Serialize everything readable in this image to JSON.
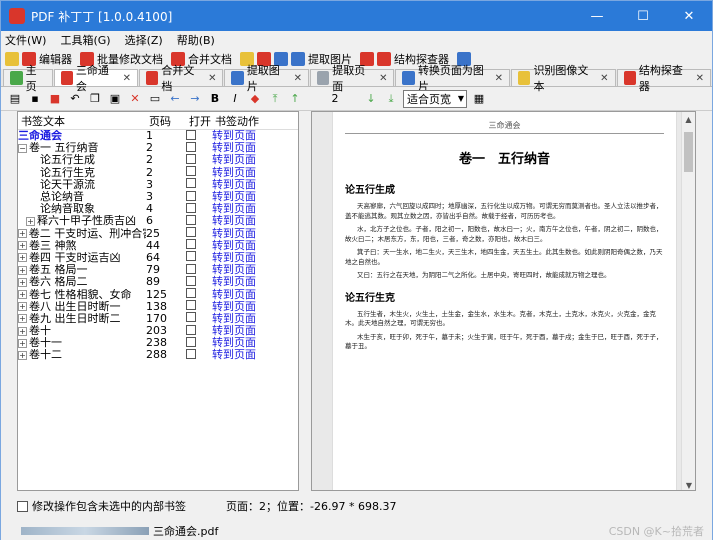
{
  "window": {
    "title": "PDF 补丁丁 [1.0.0.4100]",
    "controls": [
      "—",
      "☐",
      "✕"
    ]
  },
  "menu": [
    "文件(W)",
    "工具箱(G)",
    "选择(Z)",
    "帮助(B)"
  ],
  "toolbar1": [
    "编辑器",
    "批量修改文档",
    "合并文档",
    "提取图片",
    "结构探查器"
  ],
  "tabs": [
    {
      "label": "主页",
      "closable": false
    },
    {
      "label": "三命通会",
      "closable": true
    },
    {
      "label": "合并文档",
      "closable": true
    },
    {
      "label": "提取图片",
      "closable": true
    },
    {
      "label": "提取页面",
      "closable": true
    },
    {
      "label": "转换页面为图片",
      "closable": true
    },
    {
      "label": "识别图像文本",
      "closable": true
    },
    {
      "label": "结构探查器",
      "closable": true
    }
  ],
  "toolbar2": {
    "page_number": "2",
    "zoom": "适合页宽"
  },
  "bookmark_table": {
    "headers": [
      "书签文本",
      "页码",
      "打开",
      "书签动作"
    ],
    "rows": [
      {
        "text": "三命通会",
        "page": "1",
        "action": "转到页面",
        "level": 0,
        "toggle": "",
        "bold": true
      },
      {
        "text": "卷一 五行纳音",
        "page": "2",
        "action": "转到页面",
        "level": 0,
        "toggle": "⊟",
        "bold": false
      },
      {
        "text": "论五行生成",
        "page": "2",
        "action": "转到页面",
        "level": 2,
        "toggle": "",
        "bold": false
      },
      {
        "text": "论五行生克",
        "page": "2",
        "action": "转到页面",
        "level": 2,
        "toggle": "",
        "bold": false
      },
      {
        "text": "论天干源流",
        "page": "3",
        "action": "转到页面",
        "level": 2,
        "toggle": "",
        "bold": false
      },
      {
        "text": "总论纳音",
        "page": "3",
        "action": "转到页面",
        "level": 2,
        "toggle": "",
        "bold": false
      },
      {
        "text": "论纳音取象",
        "page": "4",
        "action": "转到页面",
        "level": 2,
        "toggle": "",
        "bold": false
      },
      {
        "text": "释六十甲子性质吉凶",
        "page": "6",
        "action": "转到页面",
        "level": 1,
        "toggle": "⊞",
        "bold": false
      },
      {
        "text": "卷二 干支时运、刑冲合害",
        "page": "25",
        "action": "转到页面",
        "level": 0,
        "toggle": "⊞",
        "bold": false
      },
      {
        "text": "卷三 神煞",
        "page": "44",
        "action": "转到页面",
        "level": 0,
        "toggle": "⊞",
        "bold": false
      },
      {
        "text": "卷四 干支时运吉凶",
        "page": "64",
        "action": "转到页面",
        "level": 0,
        "toggle": "⊞",
        "bold": false
      },
      {
        "text": "卷五 格局一",
        "page": "79",
        "action": "转到页面",
        "level": 0,
        "toggle": "⊞",
        "bold": false
      },
      {
        "text": "卷六 格局二",
        "page": "89",
        "action": "转到页面",
        "level": 0,
        "toggle": "⊞",
        "bold": false
      },
      {
        "text": "卷七 性格相貌、女命",
        "page": "125",
        "action": "转到页面",
        "level": 0,
        "toggle": "⊞",
        "bold": false
      },
      {
        "text": "卷八 出生日时断一",
        "page": "138",
        "action": "转到页面",
        "level": 0,
        "toggle": "⊞",
        "bold": false
      },
      {
        "text": "卷九 出生日时断二",
        "page": "170",
        "action": "转到页面",
        "level": 0,
        "toggle": "⊞",
        "bold": false
      },
      {
        "text": "卷十",
        "page": "203",
        "action": "转到页面",
        "level": 0,
        "toggle": "⊞",
        "bold": false
      },
      {
        "text": "卷十一",
        "page": "238",
        "action": "转到页面",
        "level": 0,
        "toggle": "⊞",
        "bold": false
      },
      {
        "text": "卷十二",
        "page": "288",
        "action": "转到页面",
        "level": 0,
        "toggle": "⊞",
        "bold": false
      }
    ]
  },
  "preview": {
    "running_head": "三命通会",
    "chapter_title": "卷一　五行纳音",
    "section1": "论五行生成",
    "para1": "天高寥廓，六气回旋以成四时；地厚幽深，五行化生以成万物。可谓无穷而莫测者也。圣人立法以推步者，盖不能逃其数。观其立数之因，亦皆出乎自然。故载于经者，可历历考也。",
    "para2": "水，北方子之位也。子者，阳之初一，阳数也，故水曰一；火，南方午之位也，午者，阴之初二，阴数也，故火曰二；木居东方，东，阳也，三者，奇之数，亦阳也，故木曰三。",
    "para3": "箕子曰：天一生水，地二生火，天三生木，地四生金，天五生土。此其生数也。如此则阴阳奇偶之数，乃天地之自然也。",
    "para4": "又曰：五行之在天地，为阴阳二气之所化。土居中央，寄旺四时，故能成就万物之理也。",
    "section2": "论五行生克",
    "para5": "五行生者，木生火，火生土，土生金，金生水，水生木。克者，木克土，土克水，水克火，火克金，金克木。此天地自然之理，可谓无穷也。",
    "para6": "木生于亥，旺于卯，死于午，墓于未；火生于寅，旺于午，死于酉，墓于戌；金生于巳，旺于酉，死于子，墓于丑。"
  },
  "status": {
    "checkbox_label": "修改操作包含未选中的内部书签",
    "position": "页面：2；位置：-26.97 * 698.37"
  },
  "taskbar": {
    "filename": "三命通会.pdf"
  },
  "watermark": "CSDN @K~拾荒者"
}
